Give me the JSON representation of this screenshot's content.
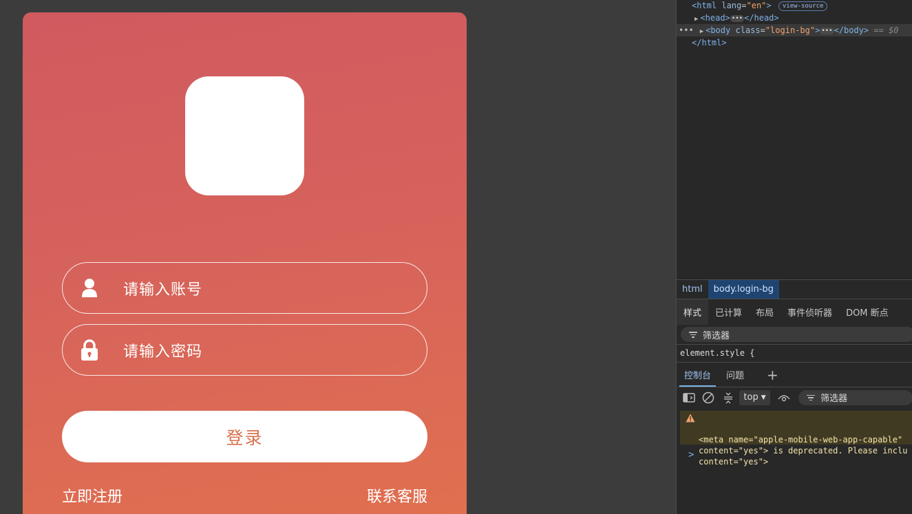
{
  "app": {
    "account_placeholder": "请输入账号",
    "password_placeholder": "请输入密码",
    "login_label": "登录",
    "register_label": "立即注册",
    "service_label": "联系客服",
    "colors": {
      "gradient_top": "#d05a5f",
      "gradient_bottom": "#e0704f",
      "button_text": "#d9704e"
    }
  },
  "devtools": {
    "dom": {
      "html_open": "<html",
      "html_attr_name": "lang",
      "html_attr_value": "\"en\"",
      "view_source": "view-source",
      "head_open": "<head>",
      "head_close": "</head>",
      "body_open": "<body",
      "body_attr_name": "class",
      "body_attr_value": "\"login-bg\"",
      "body_close": "</body>",
      "dollar_ref": "== $0",
      "html_close": "</html>"
    },
    "breadcrumbs": [
      "html",
      "body.login-bg"
    ],
    "panel_tabs": [
      "样式",
      "已计算",
      "布局",
      "事件侦听器",
      "DOM 断点"
    ],
    "filter_placeholder": "筛选器",
    "element_style": "element.style {",
    "drawer_tabs": [
      "控制台",
      "问题"
    ],
    "context": "top",
    "console_filter": "筛选器",
    "warning": {
      "line1": "<meta name=\"apple-mobile-web-app-capable\"",
      "line2": "content=\"yes\"> is deprecated. Please inclu",
      "line3": "content=\"yes\">"
    },
    "prompt": ">"
  }
}
